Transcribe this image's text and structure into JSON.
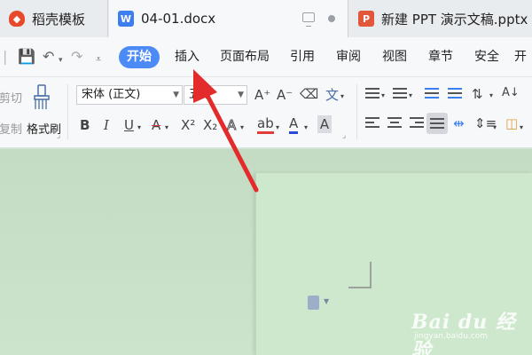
{
  "tabs": [
    {
      "label": "稻壳模板",
      "icon": "docer-icon"
    },
    {
      "label": "04-01.docx",
      "icon": "word-doc-icon",
      "badge": "W"
    },
    {
      "label": "新建 PPT 演示文稿.pptx",
      "icon": "ppt-icon",
      "badge": "P"
    }
  ],
  "menu": {
    "items": [
      "开始",
      "插入",
      "页面布局",
      "引用",
      "审阅",
      "视图",
      "章节",
      "安全",
      "开"
    ],
    "active": "开始"
  },
  "ribbon": {
    "cut_label": "剪切",
    "copy_label": "复制",
    "format_painter_label": "格式刷",
    "font_name": "宋体 (正文)",
    "font_size": "五号",
    "bold": "B",
    "italic": "I",
    "underline": "U",
    "strike": "A",
    "superscript": "X²",
    "subscript": "X₂",
    "font_color": "A",
    "grow_font": "A⁺",
    "shrink_font": "A⁻",
    "phonetic": "文",
    "highlight": "ab",
    "char_shade": "A"
  },
  "watermark": {
    "text": "Bai du 经验",
    "sub": "jingyan.baidu.com"
  },
  "colors": {
    "accent": "#4c8bf5",
    "arrow": "#e32b2b",
    "page": "#cde8cd"
  }
}
